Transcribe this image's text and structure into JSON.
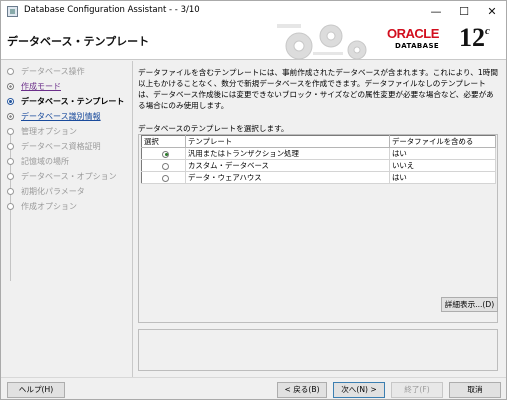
{
  "window": {
    "title": "Database Configuration Assistant - - 3/10",
    "minimize": "—",
    "maximize": "☐",
    "close": "✕"
  },
  "header": {
    "page_title": "データベース・テンプレート",
    "brand": "ORACLE",
    "product": "DATABASE",
    "version": "12",
    "version_suffix": "c"
  },
  "sidebar": {
    "steps": [
      {
        "label": "データベース操作",
        "state": "disabled"
      },
      {
        "label": "作成モード",
        "state": "visited"
      },
      {
        "label": "データベース・テンプレート",
        "state": "current"
      },
      {
        "label": "データベース識別情報",
        "state": "next"
      },
      {
        "label": "管理オプション",
        "state": "disabled"
      },
      {
        "label": "データベース資格証明",
        "state": "disabled"
      },
      {
        "label": "記憶域の場所",
        "state": "disabled"
      },
      {
        "label": "データベース・オプション",
        "state": "disabled"
      },
      {
        "label": "初期化パラメータ",
        "state": "disabled"
      },
      {
        "label": "作成オプション",
        "state": "disabled"
      }
    ]
  },
  "main": {
    "description": "データファイルを含むテンプレートには、事前作成されたデータベースが含まれます。これにより、1時間以上もかけることなく、数分で新規データベースを作成できます。データファイルなしのテンプレートは、データベース作成後には変更できないブロック・サイズなどの属性変更が必要な場合など、必要がある場合にのみ使用します。",
    "prompt": "データベースのテンプレートを選択します。",
    "table": {
      "columns": [
        "選択",
        "テンプレート",
        "データファイルを含める"
      ],
      "rows": [
        {
          "template": "汎用またはトランザクション処理",
          "includes_datafiles": "はい",
          "selected": true
        },
        {
          "template": "カスタム・データベース",
          "includes_datafiles": "いいえ",
          "selected": false
        },
        {
          "template": "データ・ウェアハウス",
          "includes_datafiles": "はい",
          "selected": false
        }
      ]
    },
    "details_button": "詳細表示...(D)"
  },
  "footer": {
    "help": "ヘルプ(H)",
    "back": "< 戻る(B)",
    "next": "次へ(N) >",
    "finish": "終了(F)",
    "cancel": "取消"
  }
}
